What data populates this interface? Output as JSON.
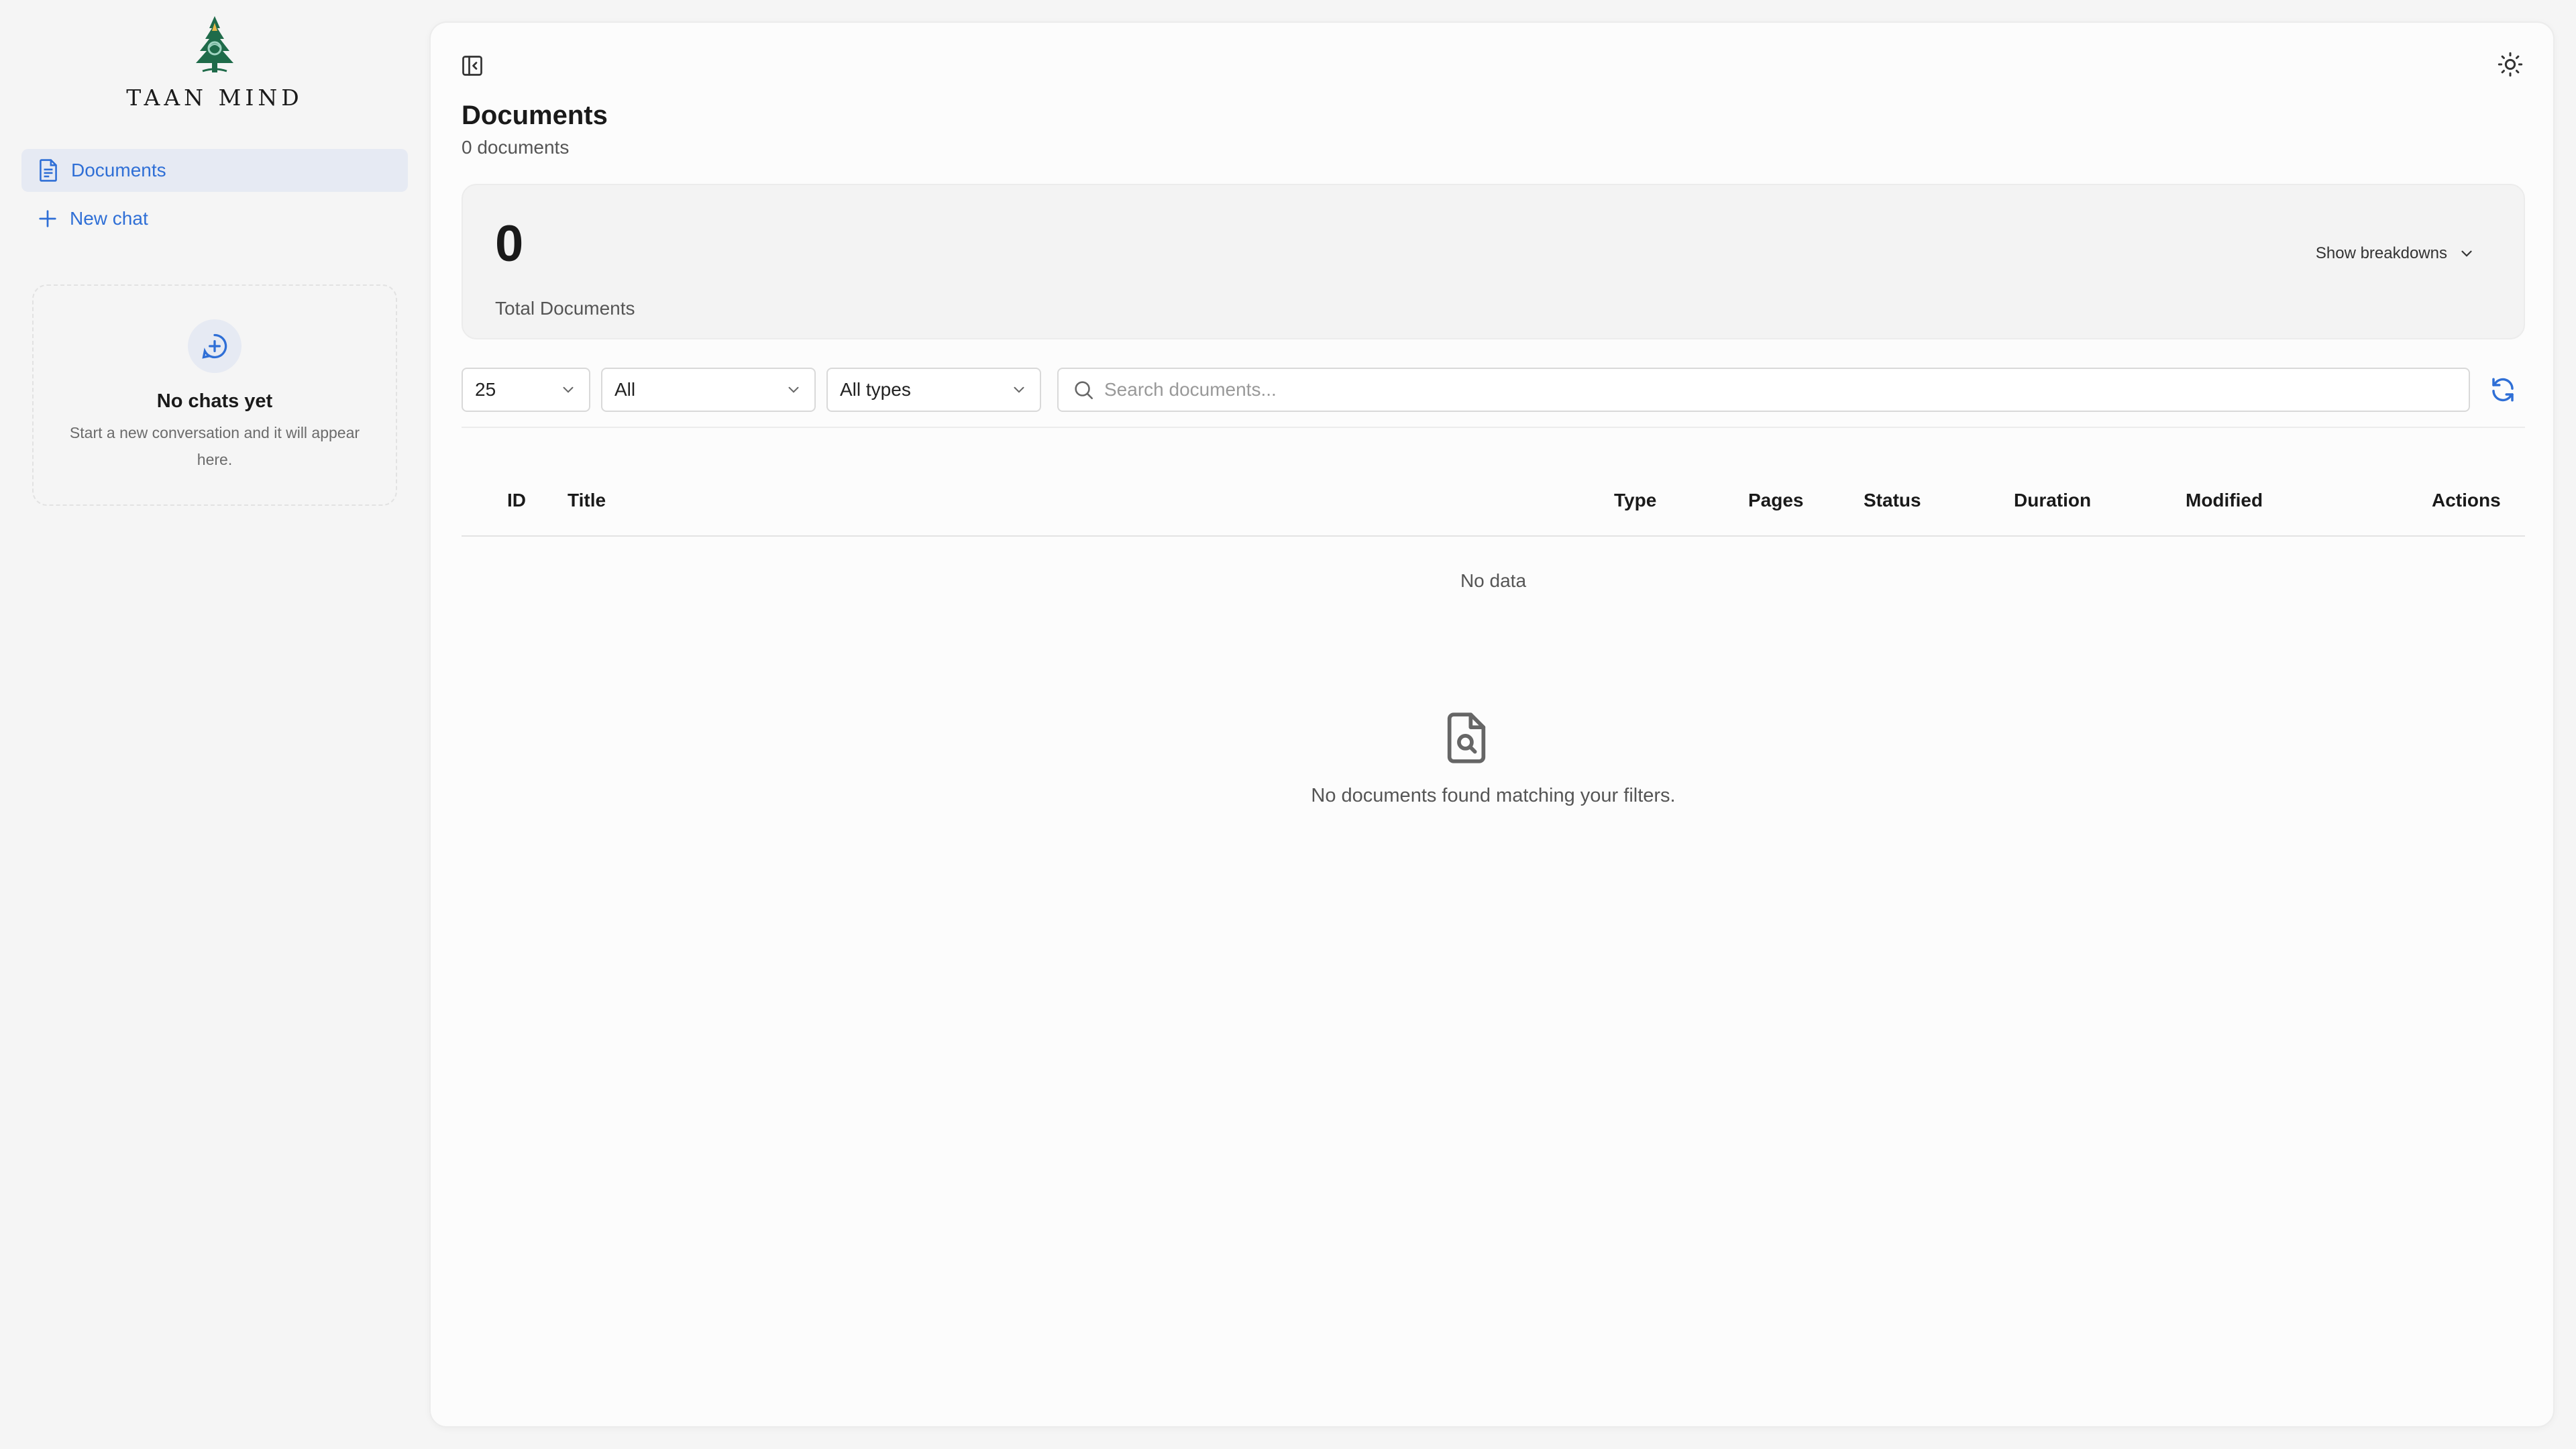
{
  "brand": {
    "name": "TAAN MIND"
  },
  "sidebar": {
    "items": [
      {
        "label": "Documents",
        "icon": "document-icon",
        "active": true
      },
      {
        "label": "New chat",
        "icon": "plus-icon",
        "active": false
      }
    ],
    "empty_chats": {
      "title": "No chats yet",
      "description": "Start a new conversation and it will appear here."
    }
  },
  "header": {
    "title": "Documents",
    "subtitle": "0 documents"
  },
  "stats": {
    "total_value": "0",
    "total_label": "Total Documents",
    "breakdown_label": "Show breakdowns"
  },
  "filters": {
    "page_size": "25",
    "status": "All",
    "type": "All types",
    "search_placeholder": "Search documents..."
  },
  "table": {
    "columns": [
      "ID",
      "Title",
      "Type",
      "Pages",
      "Status",
      "Duration",
      "Modified",
      "Actions"
    ],
    "rows": [],
    "no_data": "No data"
  },
  "empty_state": {
    "message": "No documents found matching your filters."
  },
  "colors": {
    "accent": "#2f6fd6",
    "active_bg": "#e6eaf3",
    "logo_green": "#1f6b4a"
  }
}
